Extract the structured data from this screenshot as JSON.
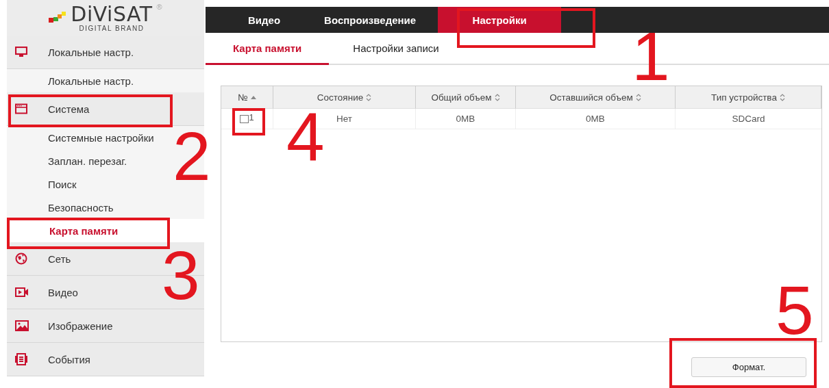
{
  "logo": {
    "name": "DiViSAT",
    "tagline": "DIGITAL BRAND",
    "mark": "®"
  },
  "sidebar": {
    "items": [
      {
        "label": "Локальные настр.",
        "children": [
          {
            "label": "Локальные настр.",
            "selected": false
          }
        ]
      },
      {
        "label": "Система",
        "children": [
          {
            "label": "Системные настройки",
            "selected": false
          },
          {
            "label": "Заплан. перезаг.",
            "selected": false
          },
          {
            "label": "Поиск",
            "selected": false
          },
          {
            "label": "Безопасность",
            "selected": false
          },
          {
            "label": "Карта памяти",
            "selected": true
          }
        ]
      },
      {
        "label": "Сеть"
      },
      {
        "label": "Видео"
      },
      {
        "label": "Изображение"
      },
      {
        "label": "События"
      }
    ]
  },
  "top_nav": {
    "tabs": [
      {
        "label": "Видео",
        "selected": false
      },
      {
        "label": "Воспроизведение",
        "selected": false
      },
      {
        "label": "Настройки",
        "selected": true
      }
    ]
  },
  "sub_tabs": [
    {
      "label": "Карта памяти",
      "selected": true
    },
    {
      "label": "Настройки записи",
      "selected": false
    }
  ],
  "table": {
    "columns": [
      "№",
      "Состояние",
      "Общий объем",
      "Оставшийся объем",
      "Тип устройства"
    ],
    "rows": [
      {
        "checked": false,
        "cells": [
          "1",
          "Нет",
          "0MB",
          "0MB",
          "SDCard"
        ]
      }
    ]
  },
  "format_button": "Формат.",
  "annotations": [
    {
      "label": "1"
    },
    {
      "label": "2"
    },
    {
      "label": "3"
    },
    {
      "label": "4"
    },
    {
      "label": "5"
    }
  ]
}
